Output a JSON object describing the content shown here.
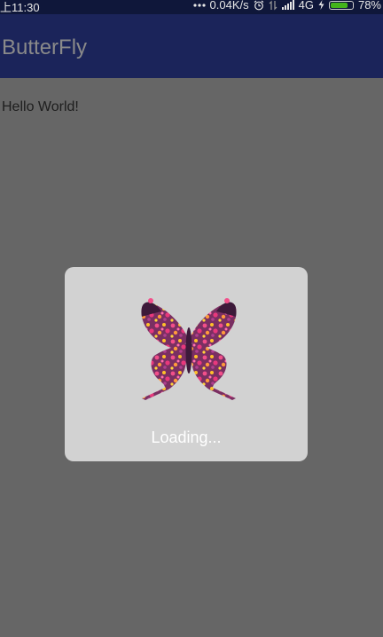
{
  "status_bar": {
    "time": "上11:30",
    "network_speed": "0.04K/s",
    "network_type": "4G",
    "battery_percent": "78%",
    "battery_level": 0.78,
    "icons": [
      "dots-icon",
      "alarm-icon",
      "data-arrows-icon",
      "signal-icon",
      "charging-icon",
      "battery-icon"
    ]
  },
  "app_bar": {
    "title": "ButterFly"
  },
  "content": {
    "text": "Hello World!"
  },
  "dialog": {
    "icon": "butterfly-icon",
    "message": "Loading..."
  },
  "colors": {
    "status_bar": "#0f173a",
    "app_bar": "#1b245a",
    "overlay": "#666666",
    "dialog": "#d2d2d2",
    "battery": "#43b51b"
  }
}
